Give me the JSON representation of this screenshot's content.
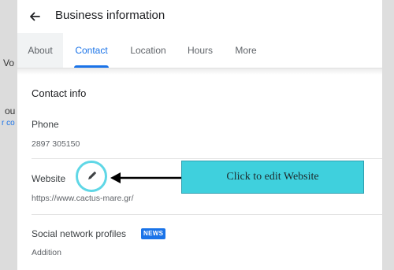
{
  "background": {
    "fragments": [
      "Vo",
      "ou",
      "r co"
    ]
  },
  "header": {
    "back_icon": "arrow-left-icon",
    "title": "Business information"
  },
  "tabs": [
    {
      "label": "About"
    },
    {
      "label": "Contact",
      "active": true
    },
    {
      "label": "Location"
    },
    {
      "label": "Hours"
    },
    {
      "label": "More"
    }
  ],
  "contact": {
    "section_title": "Contact info",
    "phone_label": "Phone",
    "phone_value": "2897 305150",
    "website_label": "Website",
    "website_value": "https://www.cactus-mare.gr/",
    "edit_icon": "pencil-icon",
    "social_label": "Social network profiles",
    "social_badge": "NEWS",
    "social_value": "Addition"
  },
  "annotation": {
    "callout_text": "Click to edit Website",
    "callout_color": "#3fd0dd",
    "highlight_color": "#5fd7e6"
  },
  "colors": {
    "accent": "#1a73e8"
  }
}
